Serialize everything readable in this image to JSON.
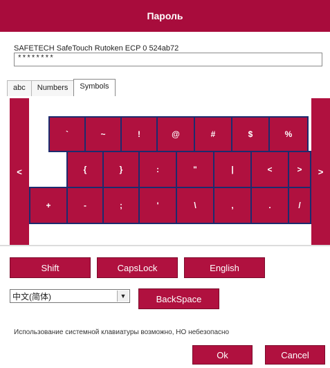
{
  "window": {
    "title": "Пароль"
  },
  "token": {
    "name": "SAFETECH SafeTouch Rutoken ECP 0 524ab72"
  },
  "password": {
    "value": "********"
  },
  "tabs": [
    {
      "label": "abc"
    },
    {
      "label": "Numbers"
    },
    {
      "label": "Symbols",
      "active": true
    }
  ],
  "keyboard": {
    "left_arrow": "<",
    "right_arrow": ">",
    "row1": [
      "`",
      "~",
      "!",
      "@",
      "#",
      "$",
      "%"
    ],
    "row2": [
      "{",
      "}",
      ":",
      "\"",
      "|",
      "<",
      ">"
    ],
    "row3": [
      "+",
      "-",
      ";",
      "'",
      "\\",
      ",",
      ".",
      "/"
    ]
  },
  "controls": {
    "shift_label": "Shift",
    "capslock_label": "CapsLock",
    "english_label": "English",
    "language_selected": "中文(简体)",
    "backspace_label": "BackSpace"
  },
  "warning": "Использование системной клавиатуры возможно, НО небезопасно",
  "footer": {
    "ok_label": "Ok",
    "cancel_label": "Cancel"
  },
  "colors": {
    "accent": "#b0113f",
    "title_bar": "#a80c3c",
    "key_border": "#1c2b6e"
  }
}
